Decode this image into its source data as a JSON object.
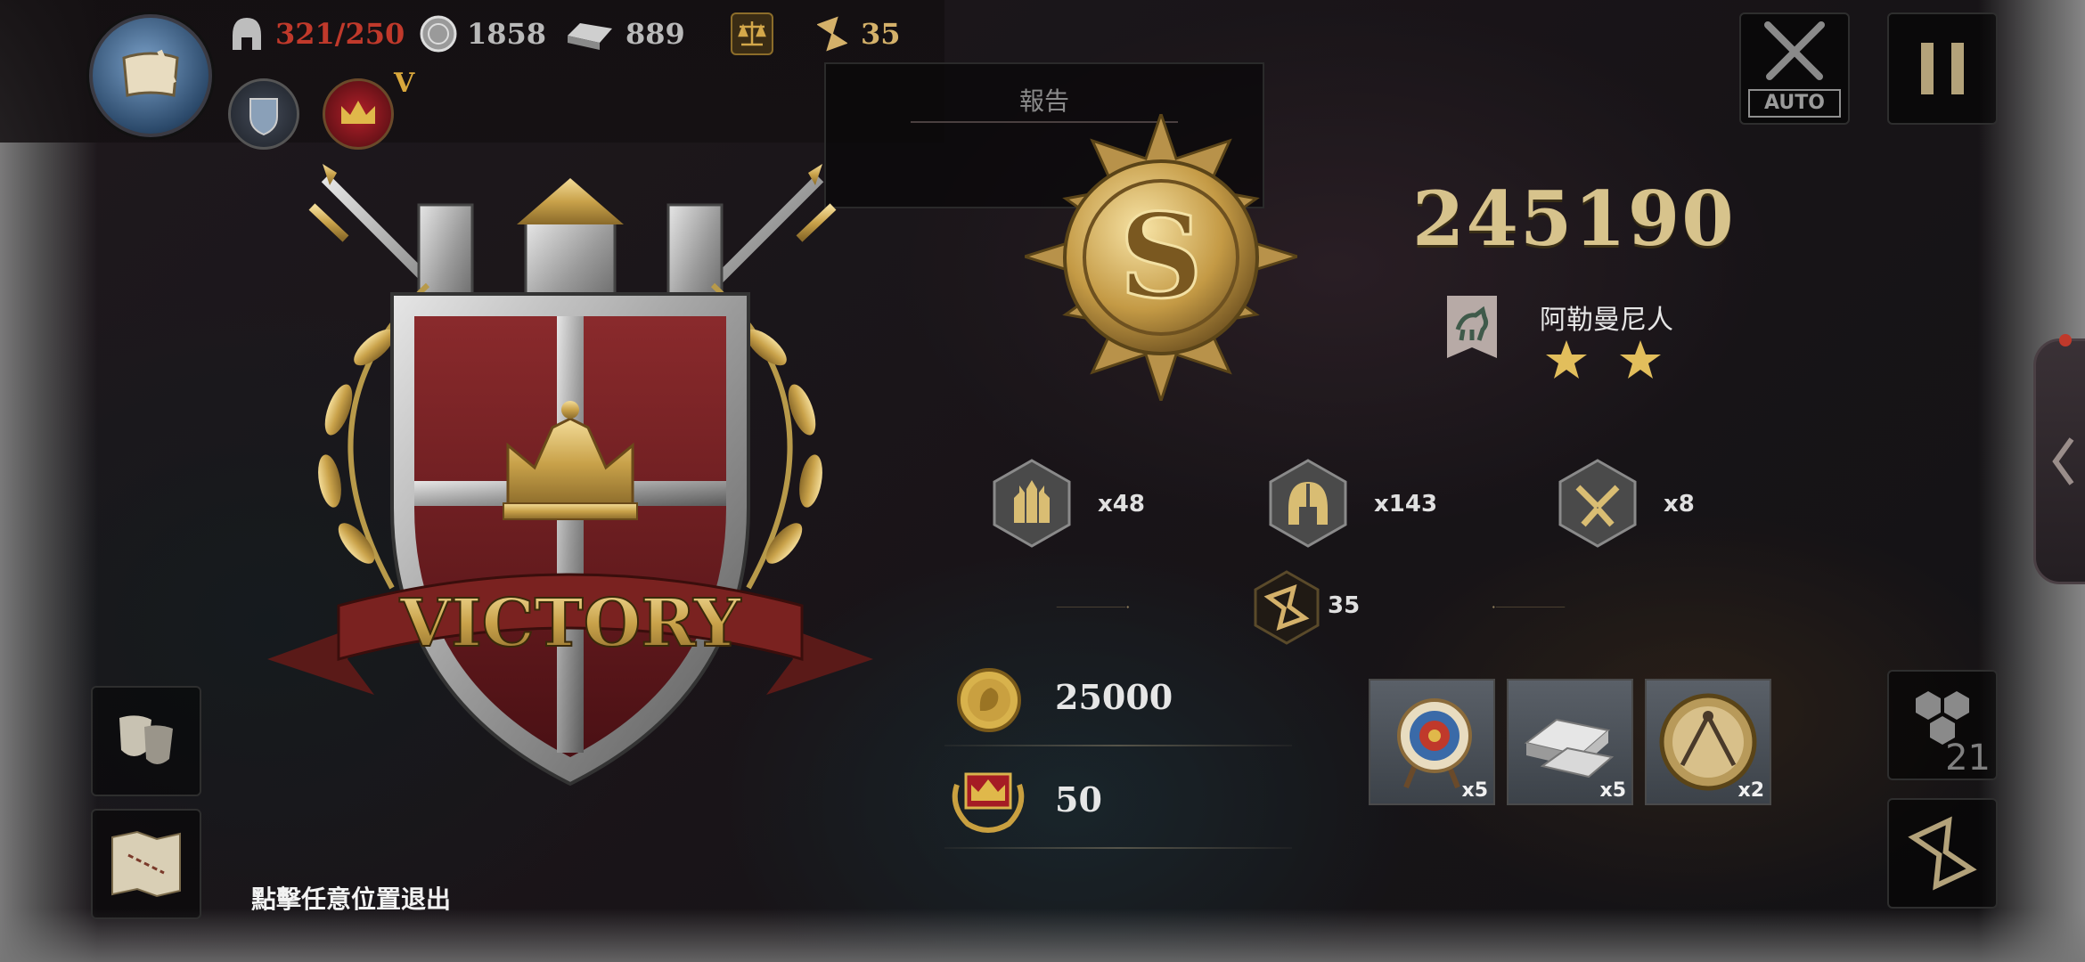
{
  "hud": {
    "troops": "321/250",
    "silver": "1858",
    "iron": "889",
    "hourglass": "35",
    "rank_mark": "V"
  },
  "report": {
    "title": "報告"
  },
  "controls": {
    "auto_label": "AUTO",
    "hex_count": "21"
  },
  "result": {
    "banner": "VICTORY",
    "grade": "S",
    "score": "245190",
    "faction": "阿勒曼尼人",
    "stars": 2
  },
  "stats": [
    {
      "icon": "castle-icon",
      "value": "x48"
    },
    {
      "icon": "helmet-icon",
      "value": "x143"
    },
    {
      "icon": "broken-swords-icon",
      "value": "x8"
    }
  ],
  "turns": "35",
  "rewards": {
    "gold": "25000",
    "honor": "50",
    "items": [
      {
        "icon": "archery-target-icon",
        "qty": "x5"
      },
      {
        "icon": "iron-ingot-icon",
        "qty": "x5"
      },
      {
        "icon": "compass-icon",
        "qty": "x2"
      }
    ]
  },
  "exit_hint": "點擊任意位置退出",
  "colors": {
    "gold": "#d7c38c",
    "shield_red": "#6d1c1e",
    "ribbon": "#7a2220",
    "troops_over": "#c0392b"
  }
}
